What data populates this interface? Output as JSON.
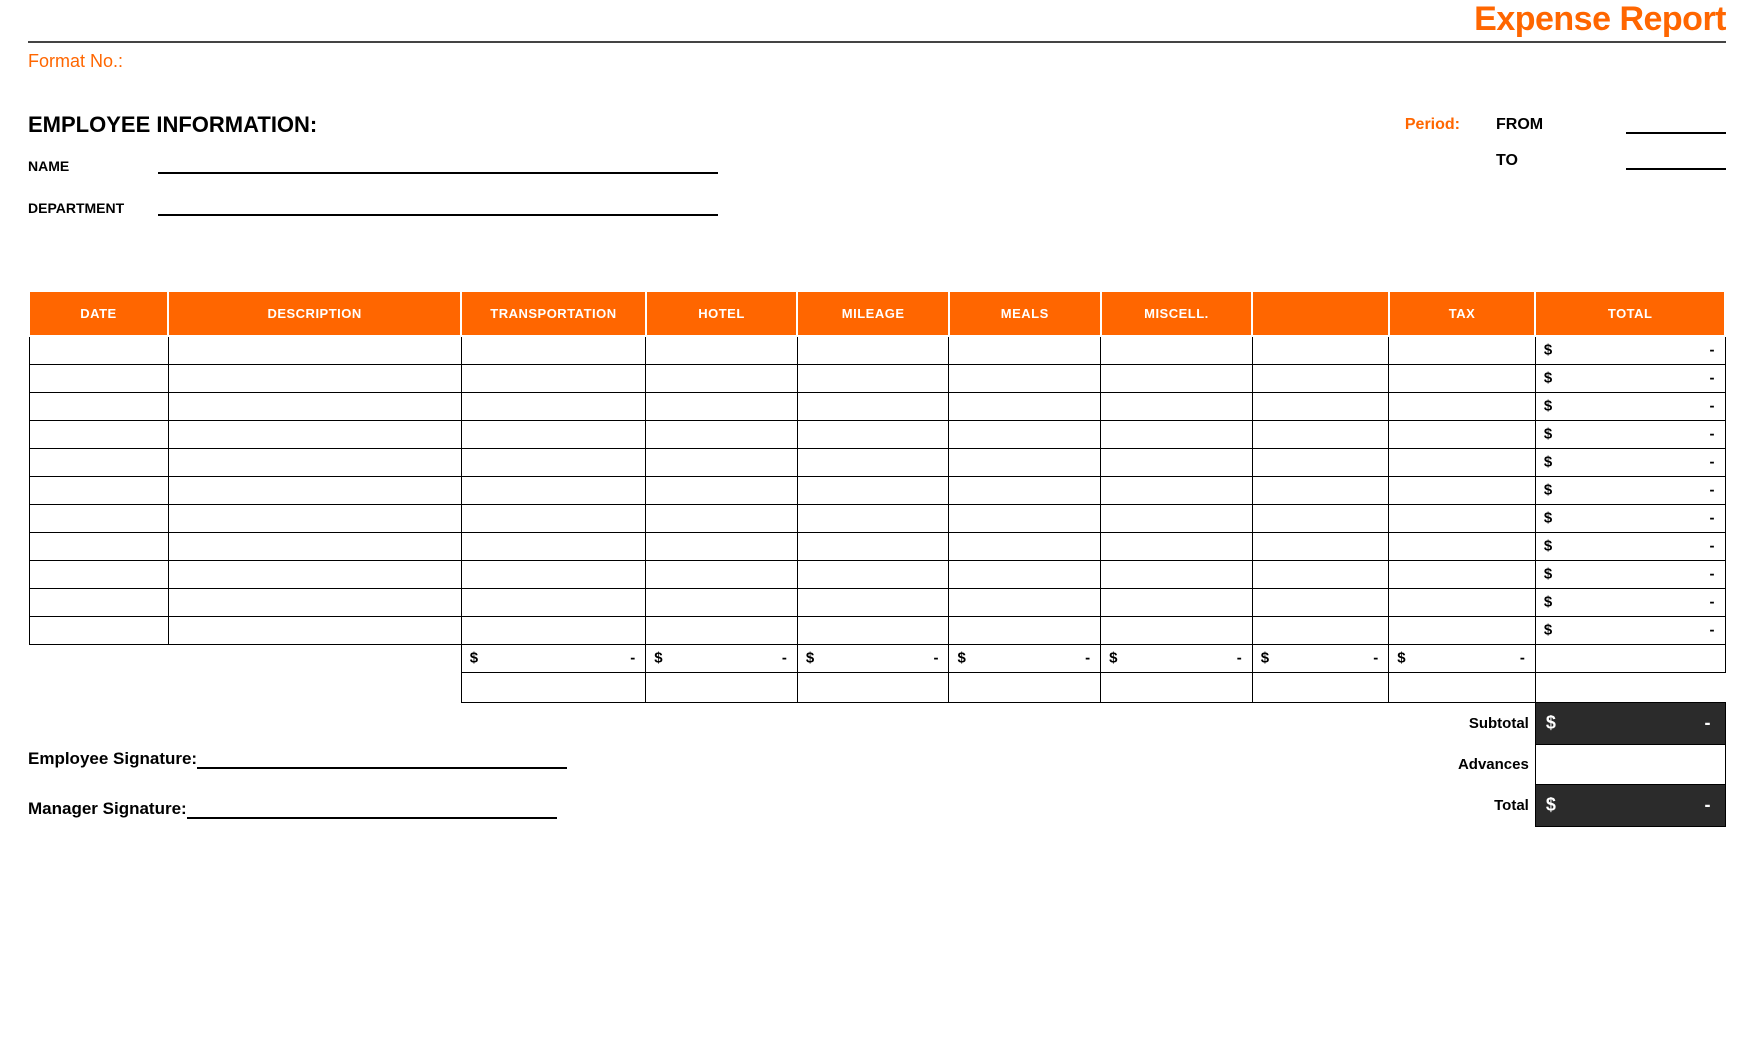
{
  "header": {
    "title": "Expense Report",
    "format_no_label": "Format No.:"
  },
  "employee_info": {
    "heading": "EMPLOYEE INFORMATION:",
    "name_label": "NAME",
    "department_label": "DEPARTMENT"
  },
  "period": {
    "label": "Period:",
    "from_label": "FROM",
    "to_label": "TO"
  },
  "table": {
    "headers": {
      "date": "DATE",
      "description": "DESCRIPTION",
      "transportation": "TRANSPORTATION",
      "hotel": "HOTEL",
      "mileage": "MILEAGE",
      "meals": "MEALS",
      "miscell": "MISCELL.",
      "blank": "",
      "tax": "TAX",
      "total": "TOTAL"
    },
    "currency": "$",
    "dash": "-",
    "row_count": 11,
    "sum_columns": [
      "transportation",
      "hotel",
      "mileage",
      "meals",
      "miscell",
      "blank",
      "tax"
    ],
    "summary": {
      "subtotal_label": "Subtotal",
      "advances_label": "Advances",
      "total_label": "Total"
    }
  },
  "signatures": {
    "employee_label": "Employee Signature:",
    "manager_label": "Manager Signature:"
  }
}
